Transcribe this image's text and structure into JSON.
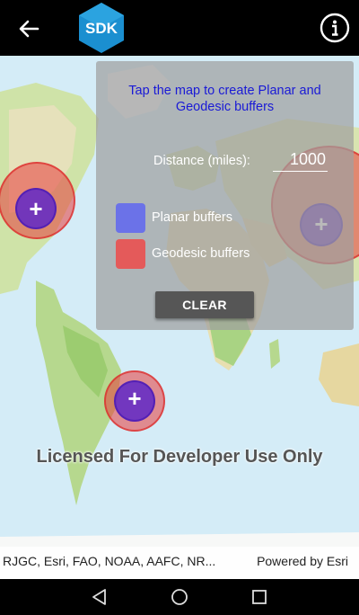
{
  "appbar": {
    "logo_text": "SDK",
    "back_icon": "arrow-left-icon",
    "info_icon": "info-circle-icon"
  },
  "panel": {
    "title": "Tap the map to create Planar and Geodesic buffers",
    "distance_label": "Distance (miles):",
    "distance_value": "1000",
    "planar_label": "Planar buffers",
    "geodesic_label": "Geodesic buffers",
    "clear_label": "CLEAR"
  },
  "map": {
    "watermark": "Licensed For Developer Use Only",
    "attribution": "RJGC, Esri, FAO, NOAA, AAFC, NR...",
    "powered_by": "Powered by Esri"
  },
  "colors": {
    "planar": "#6b72e8",
    "geodesic": "#e45a5a",
    "panel_title": "#1a1ad6"
  },
  "navbar": {
    "back": "nav-back-icon",
    "home": "nav-home-icon",
    "recents": "nav-recents-icon"
  }
}
